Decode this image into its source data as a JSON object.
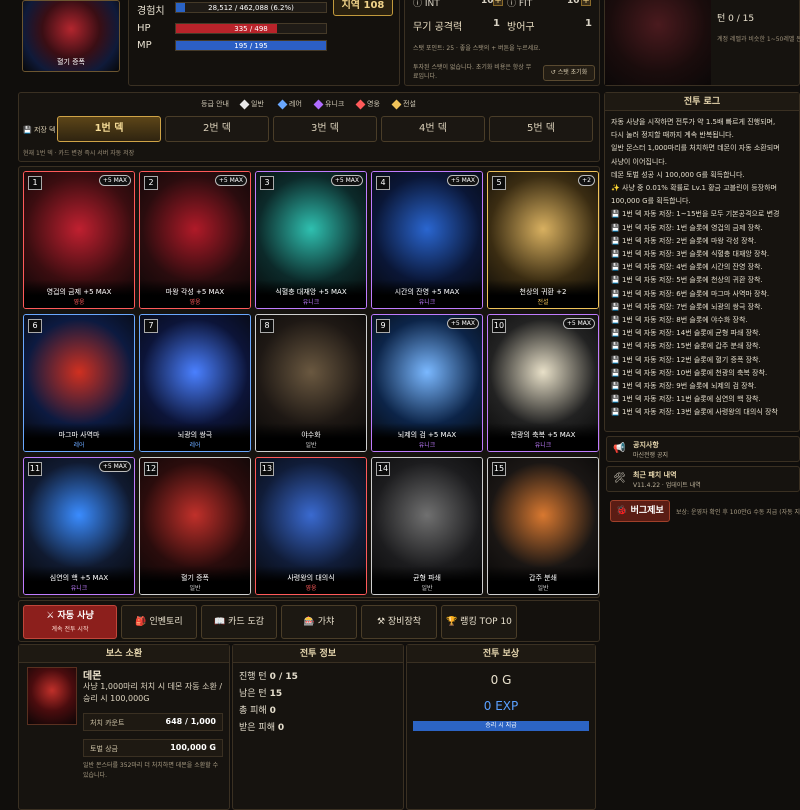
{
  "hero": {
    "label": "혈기 증폭"
  },
  "stats": {
    "exp_label": "경험치",
    "exp_text": "28,512 / 462,088 (6.2%)",
    "exp_ratio": 0.062,
    "hp_label": "HP",
    "hp_text": "335 / 498",
    "hp_ratio": 0.673,
    "mp_label": "MP",
    "mp_text": "195 / 195",
    "mp_ratio": 1.0,
    "region": "지역 108"
  },
  "attrs": {
    "int_label": "INT",
    "int_val": "10",
    "int_plus": "+",
    "fit_label": "FIT",
    "fit_val": "10",
    "fit_plus": "+",
    "atk_label": "무기 공격력",
    "atk_val": "1",
    "def_label": "방어구",
    "def_val": "1",
    "points_text": "스탯 포인트: 25 · 좋을 스탯의 + 버튼을 누르세요.",
    "reset_note": "투자된 스탯이 없습니다. 초기화 비용은 항상 무료입니다.",
    "reset_button": "↺ 스탯 초기화"
  },
  "turn": {
    "label": "턴 0 / 15",
    "desc": "계정 레벨과 비슷한 1~50레벨 몬스"
  },
  "rarity": {
    "title": "등급 안내",
    "items": [
      {
        "label": "일반",
        "color": "#e8e8e8"
      },
      {
        "label": "레어",
        "color": "#6aa8ff"
      },
      {
        "label": "유니크",
        "color": "#b06cff"
      },
      {
        "label": "영웅",
        "color": "#ff5a5a"
      },
      {
        "label": "전설",
        "color": "#f0c35a"
      }
    ]
  },
  "decks": {
    "save_label": "💾 저장 덱",
    "items": [
      "1번 덱",
      "2번 덱",
      "3번 덱",
      "4번 덱",
      "5번 덱"
    ],
    "active": 0,
    "note": "현재 1번 덱 · 카드 변경 즉시 서버 자동 저장"
  },
  "cards": [
    {
      "num": "1",
      "name": "영겁의 금제 +5 MAX",
      "rarity": "영웅",
      "rcolor": "#ff5a5a",
      "badge": "+5 MAX",
      "bg": "#3b0d10",
      "acc": "#c02030"
    },
    {
      "num": "2",
      "name": "마왕 각성 +5 MAX",
      "rarity": "영웅",
      "rcolor": "#ff5a5a",
      "badge": "+5 MAX",
      "bg": "#2a0c0e",
      "acc": "#b01a28"
    },
    {
      "num": "3",
      "name": "식혈충 대재앙 +5 MAX",
      "rarity": "유니크",
      "rcolor": "#c07cff",
      "badge": "+5 MAX",
      "bg": "#0c2a2a",
      "acc": "#2fc0b0"
    },
    {
      "num": "4",
      "name": "시간의 잔영 +5 MAX",
      "rarity": "유니크",
      "rcolor": "#c07cff",
      "badge": "+5 MAX",
      "bg": "#0a1636",
      "acc": "#2a66d0"
    },
    {
      "num": "5",
      "name": "천상의 귀환 +2",
      "rarity": "전설",
      "rcolor": "#f0c35a",
      "badge": "+2",
      "bg": "#3a2c12",
      "acc": "#d8b060"
    },
    {
      "num": "6",
      "name": "마그마 사역마",
      "rarity": "레어",
      "rcolor": "#6aa8ff",
      "badge": "",
      "bg": "#0c1a40",
      "acc": "#d03020"
    },
    {
      "num": "7",
      "name": "뇌광의 쌍극",
      "rarity": "레어",
      "rcolor": "#6aa8ff",
      "badge": "",
      "bg": "#0c1438",
      "acc": "#4a80ff"
    },
    {
      "num": "8",
      "name": "야수화",
      "rarity": "일반",
      "rcolor": "#cfcfcf",
      "badge": "",
      "bg": "#1e1814",
      "acc": "#6a5840"
    },
    {
      "num": "9",
      "name": "뇌제의 검 +5 MAX",
      "rarity": "유니크",
      "rcolor": "#c07cff",
      "badge": "+5 MAX",
      "bg": "#0c2448",
      "acc": "#7ab8ff"
    },
    {
      "num": "10",
      "name": "천광의 축복 +5 MAX",
      "rarity": "유니크",
      "rcolor": "#c07cff",
      "badge": "+5 MAX",
      "bg": "#222222",
      "acc": "#e8e0c8"
    },
    {
      "num": "11",
      "name": "심연의 핵 +5 MAX",
      "rarity": "유니크",
      "rcolor": "#c07cff",
      "badge": "+5 MAX",
      "bg": "#101a30",
      "acc": "#3a8cff"
    },
    {
      "num": "12",
      "name": "혈기 증폭",
      "rarity": "일반",
      "rcolor": "#cfcfcf",
      "badge": "",
      "bg": "#2a0c0c",
      "acc": "#c0302a"
    },
    {
      "num": "13",
      "name": "사령왕의 대의식",
      "rarity": "영웅",
      "rcolor": "#ff5a5a",
      "badge": "",
      "bg": "#101c38",
      "acc": "#3a6ad0"
    },
    {
      "num": "14",
      "name": "균형 파쇄",
      "rarity": "일반",
      "rcolor": "#cfcfcf",
      "badge": "",
      "bg": "#1c1c1e",
      "acc": "#707070"
    },
    {
      "num": "15",
      "name": "갑주 분쇄",
      "rarity": "일반",
      "rcolor": "#cfcfcf",
      "badge": "",
      "bg": "#1a1614",
      "acc": "#d87830"
    }
  ],
  "nav": {
    "hunt_label": "⚔ 자동 사냥",
    "hunt_sub": "계속 전투 시작",
    "items": [
      "🎒 인벤토리",
      "📖 카드 도감",
      "🎰 가챠",
      "⚒ 장비장착",
      "🏆 랭킹 TOP 10"
    ]
  },
  "boss": {
    "title": "보스 소환",
    "name": "데몬",
    "desc": "사냥 1,000마리 처치 시 데몬 자동 소환 / 승리 시 100,000G",
    "kill_label": "처치 카운트",
    "kill_val": "648 / 1,000",
    "reward_label": "토벌 상금",
    "reward_val": "100,000 G",
    "foot": "일반 몬스터를 352마리 더 처치하면 데몬을 소환할 수 있습니다."
  },
  "battle": {
    "title": "전투 정보",
    "rows": [
      {
        "label": "진행 턴",
        "val": "0 / 15"
      },
      {
        "label": "남은 턴",
        "val": "15"
      },
      {
        "label": "총 피해",
        "val": "0"
      },
      {
        "label": "받은 피해",
        "val": "0"
      }
    ]
  },
  "reward": {
    "title": "전투 보상",
    "gold": "0 G",
    "exp": "0 EXP",
    "bar_label": "승리 시 지급"
  },
  "log": {
    "title": "전투 로그",
    "lines": [
      {
        "t": "자동 사냥을 시작하면 전투가 약 1.5배 빠르게 진행되며,",
        "c": "#e4ddcc"
      },
      {
        "t": "다시 눌러 정지할 때까지 계속 반복됩니다.",
        "c": "#e4ddcc"
      },
      {
        "t": "일반 몬스터 1,000마리를 처치하면 데몬이 자동 소환되며",
        "c": "#e4ddcc"
      },
      {
        "t": "사냥이 이어집니다.",
        "c": "#e4ddcc"
      },
      {
        "t": "데몬 토벌 성공 시 100,000 G를 획득합니다.",
        "c": "#e4ddcc"
      },
      {
        "t": "✨ 사냥 중 0.01% 확률로 Lv.1 황금 고블린이 등장하며",
        "c": "#e4ddcc"
      },
      {
        "t": "100,000 G를 획득합니다.",
        "c": "#e4ddcc"
      },
      {
        "t": "💾 1번 덱 자동 저장: 1~15번을 모두 기본공격으로 변경",
        "c": "#e4ddcc"
      },
      {
        "t": "💾 1번 덱 자동 저장: 1번 슬롯에 영겁의 금제 장착.",
        "c": "#e4ddcc"
      },
      {
        "t": "💾 1번 덱 자동 저장: 2번 슬롯에 마왕 각성 장착.",
        "c": "#e4ddcc"
      },
      {
        "t": "💾 1번 덱 자동 저장: 3번 슬롯에 식혈충 대재앙 장착.",
        "c": "#e4ddcc"
      },
      {
        "t": "💾 1번 덱 자동 저장: 4번 슬롯에 시간의 잔영 장착.",
        "c": "#e4ddcc"
      },
      {
        "t": "💾 1번 덱 자동 저장: 5번 슬롯에 천상의 귀환 장착.",
        "c": "#e4ddcc"
      },
      {
        "t": "💾 1번 덱 자동 저장: 6번 슬롯에 마그마 사역마 장착.",
        "c": "#e4ddcc"
      },
      {
        "t": "💾 1번 덱 자동 저장: 7번 슬롯에 뇌광의 쌍극 장착.",
        "c": "#e4ddcc"
      },
      {
        "t": "💾 1번 덱 자동 저장: 8번 슬롯에 야수화 장착.",
        "c": "#e4ddcc"
      },
      {
        "t": "💾 1번 덱 자동 저장: 14번 슬롯에 균형 파쇄 장착.",
        "c": "#e4ddcc"
      },
      {
        "t": "💾 1번 덱 자동 저장: 15번 슬롯에 갑주 분쇄 장착.",
        "c": "#e4ddcc"
      },
      {
        "t": "💾 1번 덱 자동 저장: 12번 슬롯에 혈기 증폭 장착.",
        "c": "#e4ddcc"
      },
      {
        "t": "💾 1번 덱 자동 저장: 10번 슬롯에 천광의 축복 장착.",
        "c": "#e4ddcc"
      },
      {
        "t": "💾 1번 덱 자동 저장: 9번 슬롯에 뇌제의 검 장착.",
        "c": "#e4ddcc"
      },
      {
        "t": "💾 1번 덱 자동 저장: 11번 슬롯에 심연의 핵 장착.",
        "c": "#e4ddcc"
      },
      {
        "t": "💾 1번 덱 자동 저장: 13번 슬롯에 사령왕의 대의식 장착",
        "c": "#e4ddcc"
      }
    ]
  },
  "notice": {
    "title": "공지사항",
    "sub": "마신전쟁 공지"
  },
  "patch": {
    "title": "최근 패치 내역",
    "sub": "V11.4.22 · 업데이트 내역"
  },
  "bug": {
    "button": "🐞 버그제보",
    "desc": "보상: 운영자 확인 후 100만G 수동 지급 (자동 지급"
  }
}
